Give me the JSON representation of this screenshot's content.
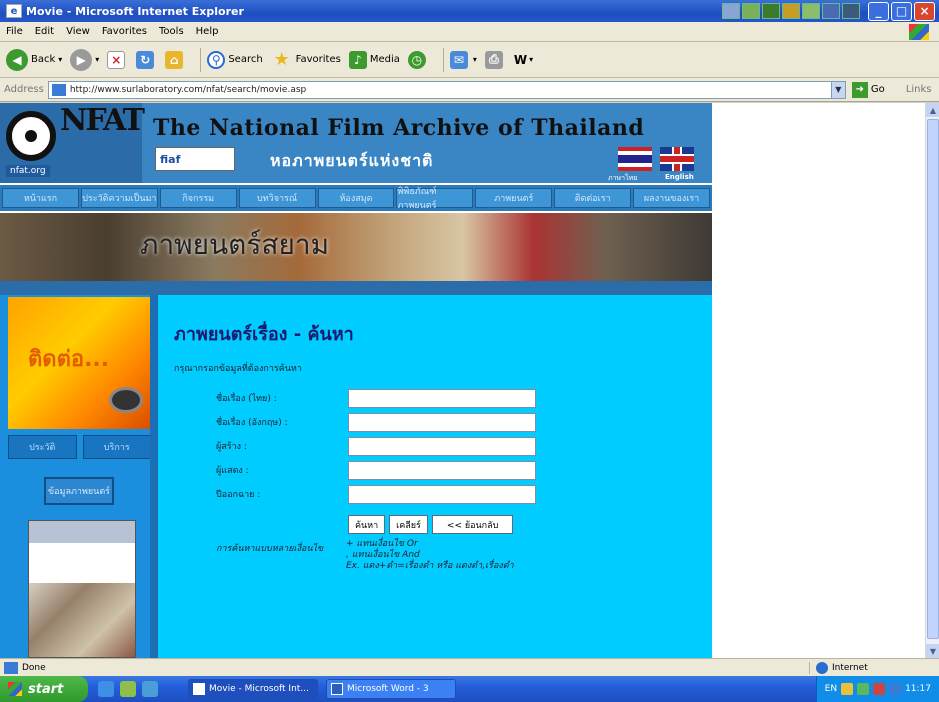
{
  "window": {
    "title": "Movie - Microsoft Internet Explorer",
    "min": "_",
    "max": "□",
    "close": "×"
  },
  "menu": [
    "File",
    "Edit",
    "View",
    "Favorites",
    "Tools",
    "Help"
  ],
  "toolbar": {
    "back": "Back",
    "search": "Search",
    "favorites": "Favorites",
    "media": "Media"
  },
  "address": {
    "label": "Address",
    "url": "http://www.surlaboratory.com/nfat/search/movie.asp",
    "go": "Go",
    "links": "Links"
  },
  "site": {
    "logo_letters": "NFAT",
    "logo_url": "nfat.org",
    "title": "The National Film Archive of Thailand",
    "fiaf": "fiaf",
    "thai_title": "หอภาพยนตร์แห่งชาติ",
    "lang_th": "ภาษาไทย",
    "lang_en": "English",
    "nav": [
      "หน้าแรก",
      "ประวัติความเป็นมา",
      "กิจกรรม",
      "บทวิจารณ์",
      "ห้องสมุด",
      "พิพิธภัณฑ์ภาพยนตร์",
      "ภาพยนตร์",
      "ติดต่อเรา",
      "ผลงานของเรา"
    ],
    "banner_text": "ภาพยนตร์สยาม"
  },
  "left": {
    "contact": "ติดต่อ...",
    "btn1": "ประวัติ",
    "btn2": "บริการ",
    "btn3": "ข้อมูลภาพยนตร์"
  },
  "main": {
    "heading": "ภาพยนตร์เรื่อง - ค้นหา",
    "subnote": "กรุณากรอกข้อมูลที่ต้องการค้นหา",
    "fields": [
      {
        "label": "ชื่อเรื่อง (ไทย) :",
        "value": ""
      },
      {
        "label": "ชื่อเรื่อง (อังกฤษ) :",
        "value": ""
      },
      {
        "label": "ผู้สร้าง :",
        "value": ""
      },
      {
        "label": "ผู้แสดง :",
        "value": ""
      },
      {
        "label": "ปีออกฉาย :",
        "value": ""
      }
    ],
    "btn_search": "ค้นหา",
    "btn_clear": "เคลียร์",
    "btn_back": "<< ย้อนกลับ",
    "hint_label": "การค้นหาแบบหลายเงื่อนไข",
    "hints": [
      "+ แทนเงื่อนไข Or",
      ", แทนเงื่อนไข And",
      "Ex. แดง+ดำ=เรื่องดำ หรือ แดงดำ,เรื่องดำ"
    ]
  },
  "status": {
    "text": "Done",
    "zone": "Internet"
  },
  "taskbar": {
    "start": "start",
    "item1": "Movie - Microsoft Int...",
    "item2": "Microsoft Word - 3",
    "clock": "11:17",
    "lang": "EN"
  }
}
